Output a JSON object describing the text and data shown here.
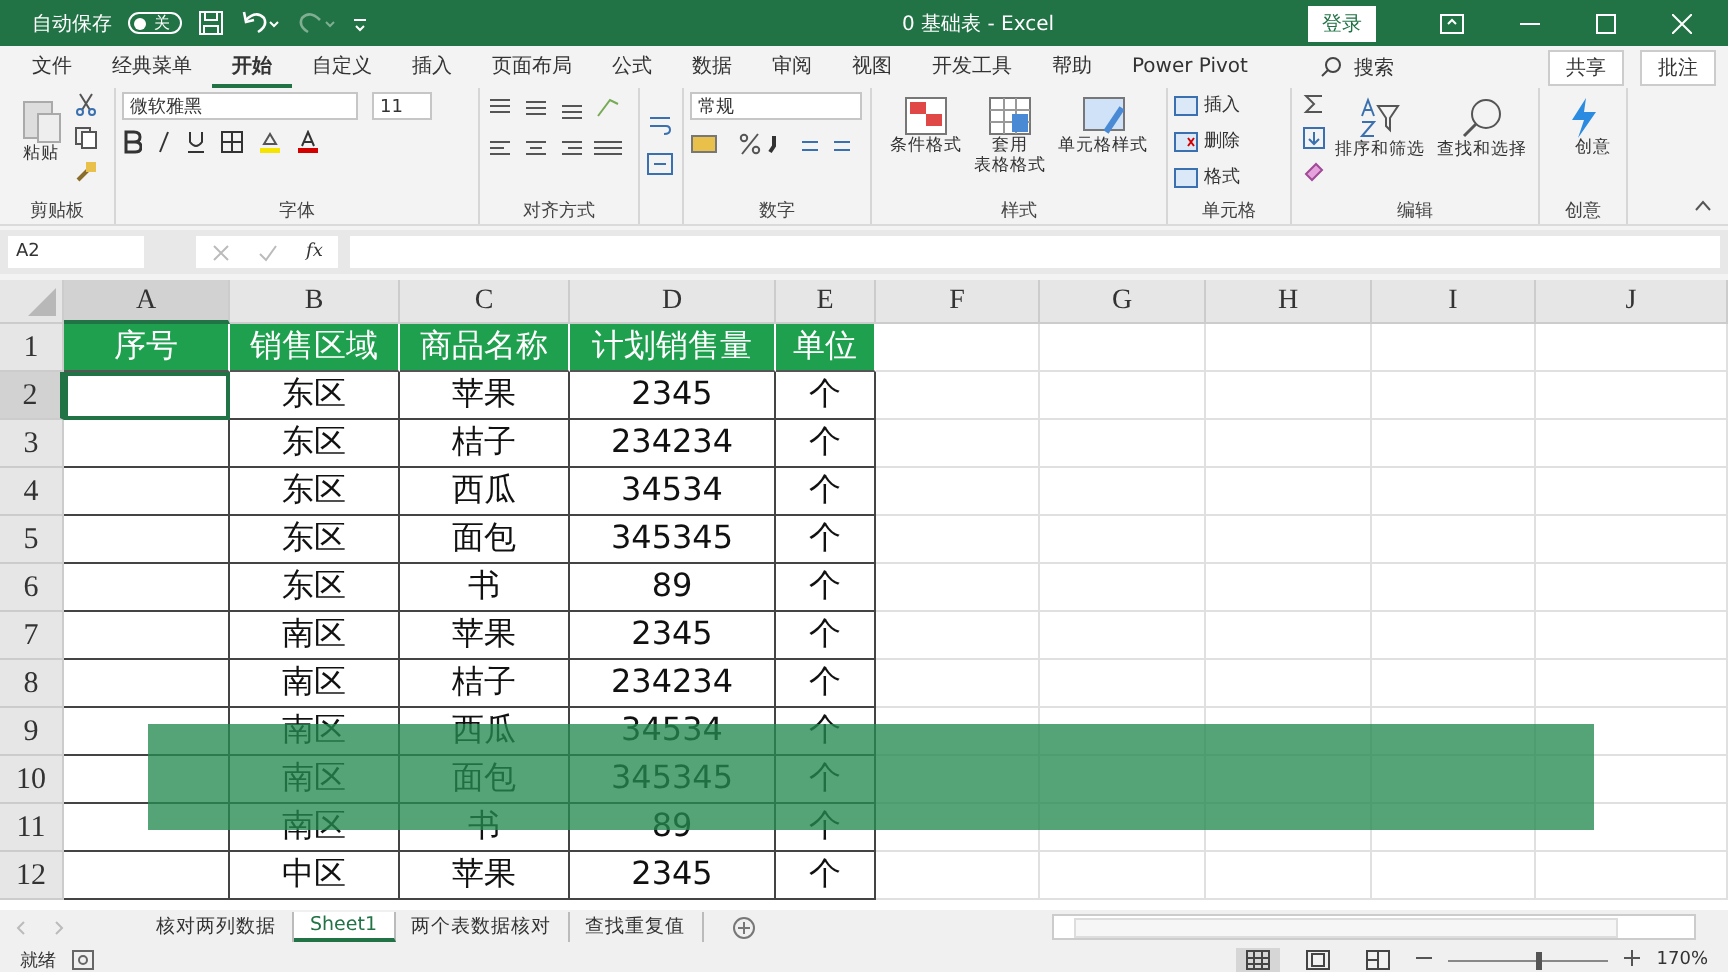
{
  "title_bar": {
    "autosave_label": "自动保存",
    "autosave_state": "关",
    "autosave_on": false,
    "document_title": "0 基础表 - Excel",
    "login": "登录"
  },
  "menu_tabs": [
    {
      "label": "文件",
      "selected": false
    },
    {
      "label": "经典菜单",
      "selected": false
    },
    {
      "label": "开始",
      "selected": true
    },
    {
      "label": "自定义",
      "selected": false
    },
    {
      "label": "插入",
      "selected": false
    },
    {
      "label": "页面布局",
      "selected": false
    },
    {
      "label": "公式",
      "selected": false
    },
    {
      "label": "数据",
      "selected": false
    },
    {
      "label": "审阅",
      "selected": false
    },
    {
      "label": "视图",
      "selected": false
    },
    {
      "label": "开发工具",
      "selected": false
    },
    {
      "label": "帮助",
      "selected": false
    },
    {
      "label": "Power Pivot",
      "selected": false
    }
  ],
  "search": "搜索",
  "share": "共享",
  "comments": "批注",
  "ribbon": {
    "paste": "粘贴",
    "clipboard_group": "剪贴板",
    "font_name": "微软雅黑",
    "font_size": "11",
    "font_group": "字体",
    "alignment_group": "对齐方式",
    "number_format": "常规",
    "number_group": "数字",
    "style_buttons": [
      {
        "lines": [
          "条件格式"
        ]
      },
      {
        "lines": [
          "套用",
          "表格格式"
        ]
      },
      {
        "lines": [
          "单元格样式"
        ]
      }
    ],
    "styles_group": "样式",
    "cell_buttons": [
      "插入",
      "删除",
      "格式"
    ],
    "cells_group": "单元格",
    "edit_buttons": [
      "排序和筛选",
      "查找和选择"
    ],
    "editing_group": "编辑",
    "ideas_button": "创意",
    "ideas_group": "创意"
  },
  "formula_bar": {
    "name_box": "A2",
    "function_label": "fx"
  },
  "columns": [
    {
      "label": "A",
      "selected": true
    },
    {
      "label": "B",
      "selected": false
    },
    {
      "label": "C",
      "selected": false
    },
    {
      "label": "D",
      "selected": false
    },
    {
      "label": "E",
      "selected": false
    },
    {
      "label": "F",
      "selected": false
    },
    {
      "label": "G",
      "selected": false
    },
    {
      "label": "H",
      "selected": false
    },
    {
      "label": "I",
      "selected": false
    },
    {
      "label": "J",
      "selected": false
    }
  ],
  "header_row": {
    "number": "1",
    "cells": [
      "序号",
      "销售区域",
      "商品名称",
      "计划销售量",
      "单位"
    ]
  },
  "rows": [
    {
      "number": "2",
      "selected": true,
      "cells": [
        "东区",
        "苹果",
        "2345",
        "个"
      ]
    },
    {
      "number": "3",
      "selected": false,
      "cells": [
        "东区",
        "桔子",
        "234234",
        "个"
      ]
    },
    {
      "number": "4",
      "selected": false,
      "cells": [
        "东区",
        "西瓜",
        "34534",
        "个"
      ]
    },
    {
      "number": "5",
      "selected": false,
      "cells": [
        "东区",
        "面包",
        "345345",
        "个"
      ]
    },
    {
      "number": "6",
      "selected": false,
      "cells": [
        "东区",
        "书",
        "89",
        "个"
      ]
    },
    {
      "number": "7",
      "selected": false,
      "cells": [
        "南区",
        "苹果",
        "2345",
        "个"
      ]
    },
    {
      "number": "8",
      "selected": false,
      "cells": [
        "南区",
        "桔子",
        "234234",
        "个"
      ]
    },
    {
      "number": "9",
      "selected": false,
      "cells": [
        "南区",
        "西瓜",
        "34534",
        "个"
      ]
    },
    {
      "number": "10",
      "selected": false,
      "cells": [
        "南区",
        "面包",
        "345345",
        "个"
      ]
    },
    {
      "number": "11",
      "selected": false,
      "cells": [
        "南区",
        "书",
        "89",
        "个"
      ]
    },
    {
      "number": "12",
      "selected": false,
      "cells": [
        "中区",
        "苹果",
        "2345",
        "个"
      ]
    }
  ],
  "sheet_tabs": [
    {
      "label": "核对两列数据",
      "selected": false
    },
    {
      "label": "Sheet1",
      "selected": true
    },
    {
      "label": "两个表数据核对",
      "selected": false
    },
    {
      "label": "查找重复值",
      "selected": false
    }
  ],
  "status_bar": {
    "status": "就绪",
    "zoom": "170%",
    "zoom_slider": {
      "level": 0.55
    }
  }
}
